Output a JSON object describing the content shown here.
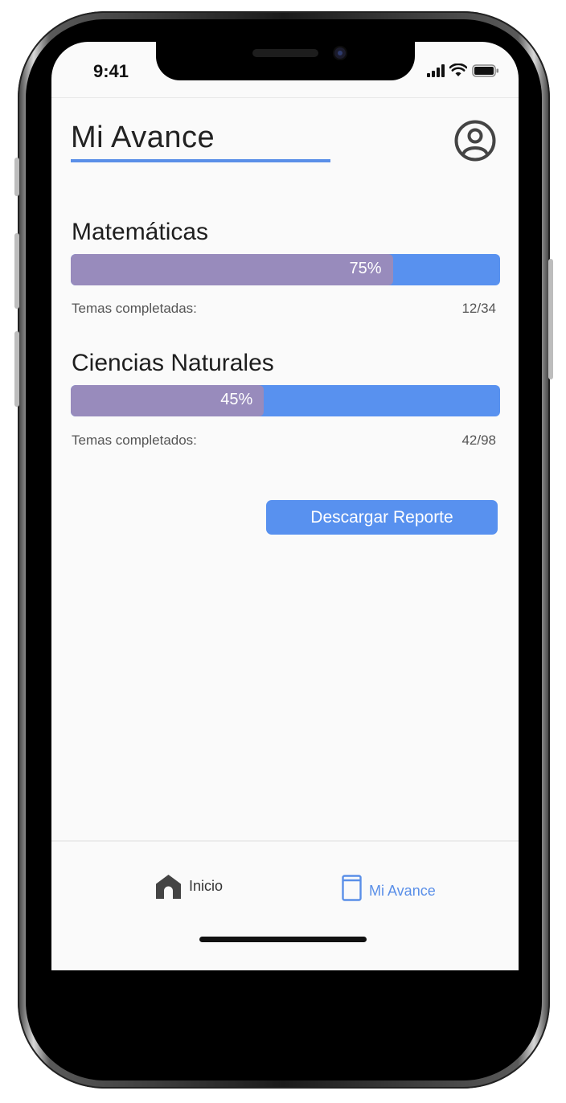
{
  "status_bar": {
    "time": "9:41"
  },
  "header": {
    "title": "Mi Avance"
  },
  "subjects": [
    {
      "name": "Matemáticas",
      "progress": 0.75,
      "progress_label": "75%",
      "topics_label": "Temas completadas:",
      "topics_count": "12/34"
    },
    {
      "name": "Ciencias Naturales",
      "progress": 0.45,
      "progress_label": "45%",
      "topics_label": "Temas completados:",
      "topics_count": "42/98"
    }
  ],
  "actions": {
    "download_label": "Descargar Reporte"
  },
  "bottom_nav": {
    "items": [
      {
        "label": "Inicio",
        "icon": "home-icon",
        "active": false
      },
      {
        "label": "Mi Avance",
        "icon": "book-icon",
        "active": true
      }
    ]
  },
  "colors": {
    "accent": "#5891ef",
    "progress_fill": "#988bbc",
    "active_nav": "#5a8fe8"
  }
}
